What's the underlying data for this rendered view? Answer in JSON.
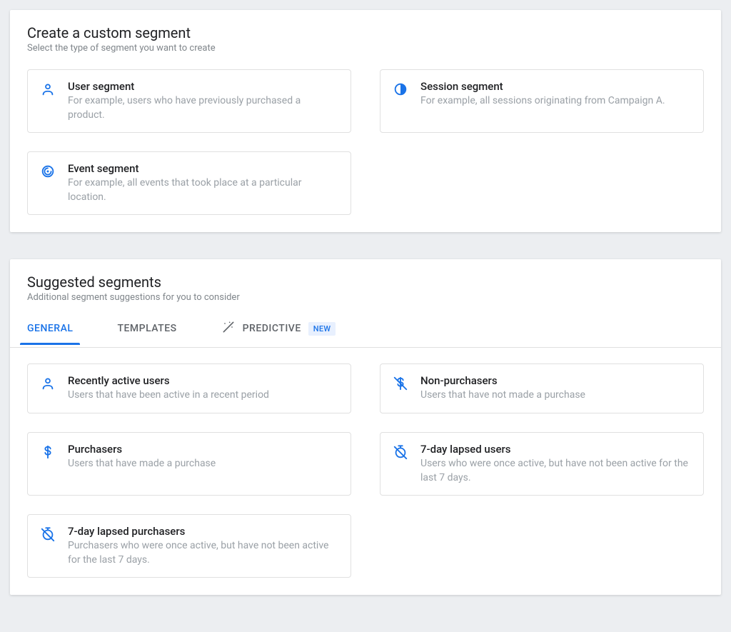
{
  "custom": {
    "title": "Create a custom segment",
    "subtitle": "Select the type of segment you want to create",
    "items": [
      {
        "icon": "user-icon",
        "title": "User segment",
        "desc": "For example, users who have previously purchased a product."
      },
      {
        "icon": "session-icon",
        "title": "Session segment",
        "desc": "For example, all sessions originating from Campaign A."
      },
      {
        "icon": "event-icon",
        "title": "Event segment",
        "desc": "For example, all events that took place at a particular location."
      }
    ]
  },
  "suggested": {
    "title": "Suggested segments",
    "subtitle": "Additional segment suggestions for you to consider",
    "tabs": [
      {
        "label": "GENERAL",
        "active": true
      },
      {
        "label": "TEMPLATES"
      },
      {
        "label": "PREDICTIVE",
        "icon": "wand-icon",
        "badge": "NEW"
      }
    ],
    "items": [
      {
        "icon": "user-icon",
        "title": "Recently active users",
        "desc": "Users that have been active in a recent period"
      },
      {
        "icon": "nopurchase-icon",
        "title": "Non-purchasers",
        "desc": "Users that have not made a purchase"
      },
      {
        "icon": "dollar-icon",
        "title": "Purchasers",
        "desc": "Users that have made a purchase"
      },
      {
        "icon": "lapsed-icon",
        "title": "7-day lapsed users",
        "desc": "Users who were once active, but have not been active for the last 7 days."
      },
      {
        "icon": "lapsed-icon",
        "title": "7-day lapsed purchasers",
        "desc": "Purchasers who were once active, but have not been active for the last 7 days."
      }
    ]
  },
  "colors": {
    "accent": "#1a73e8"
  }
}
